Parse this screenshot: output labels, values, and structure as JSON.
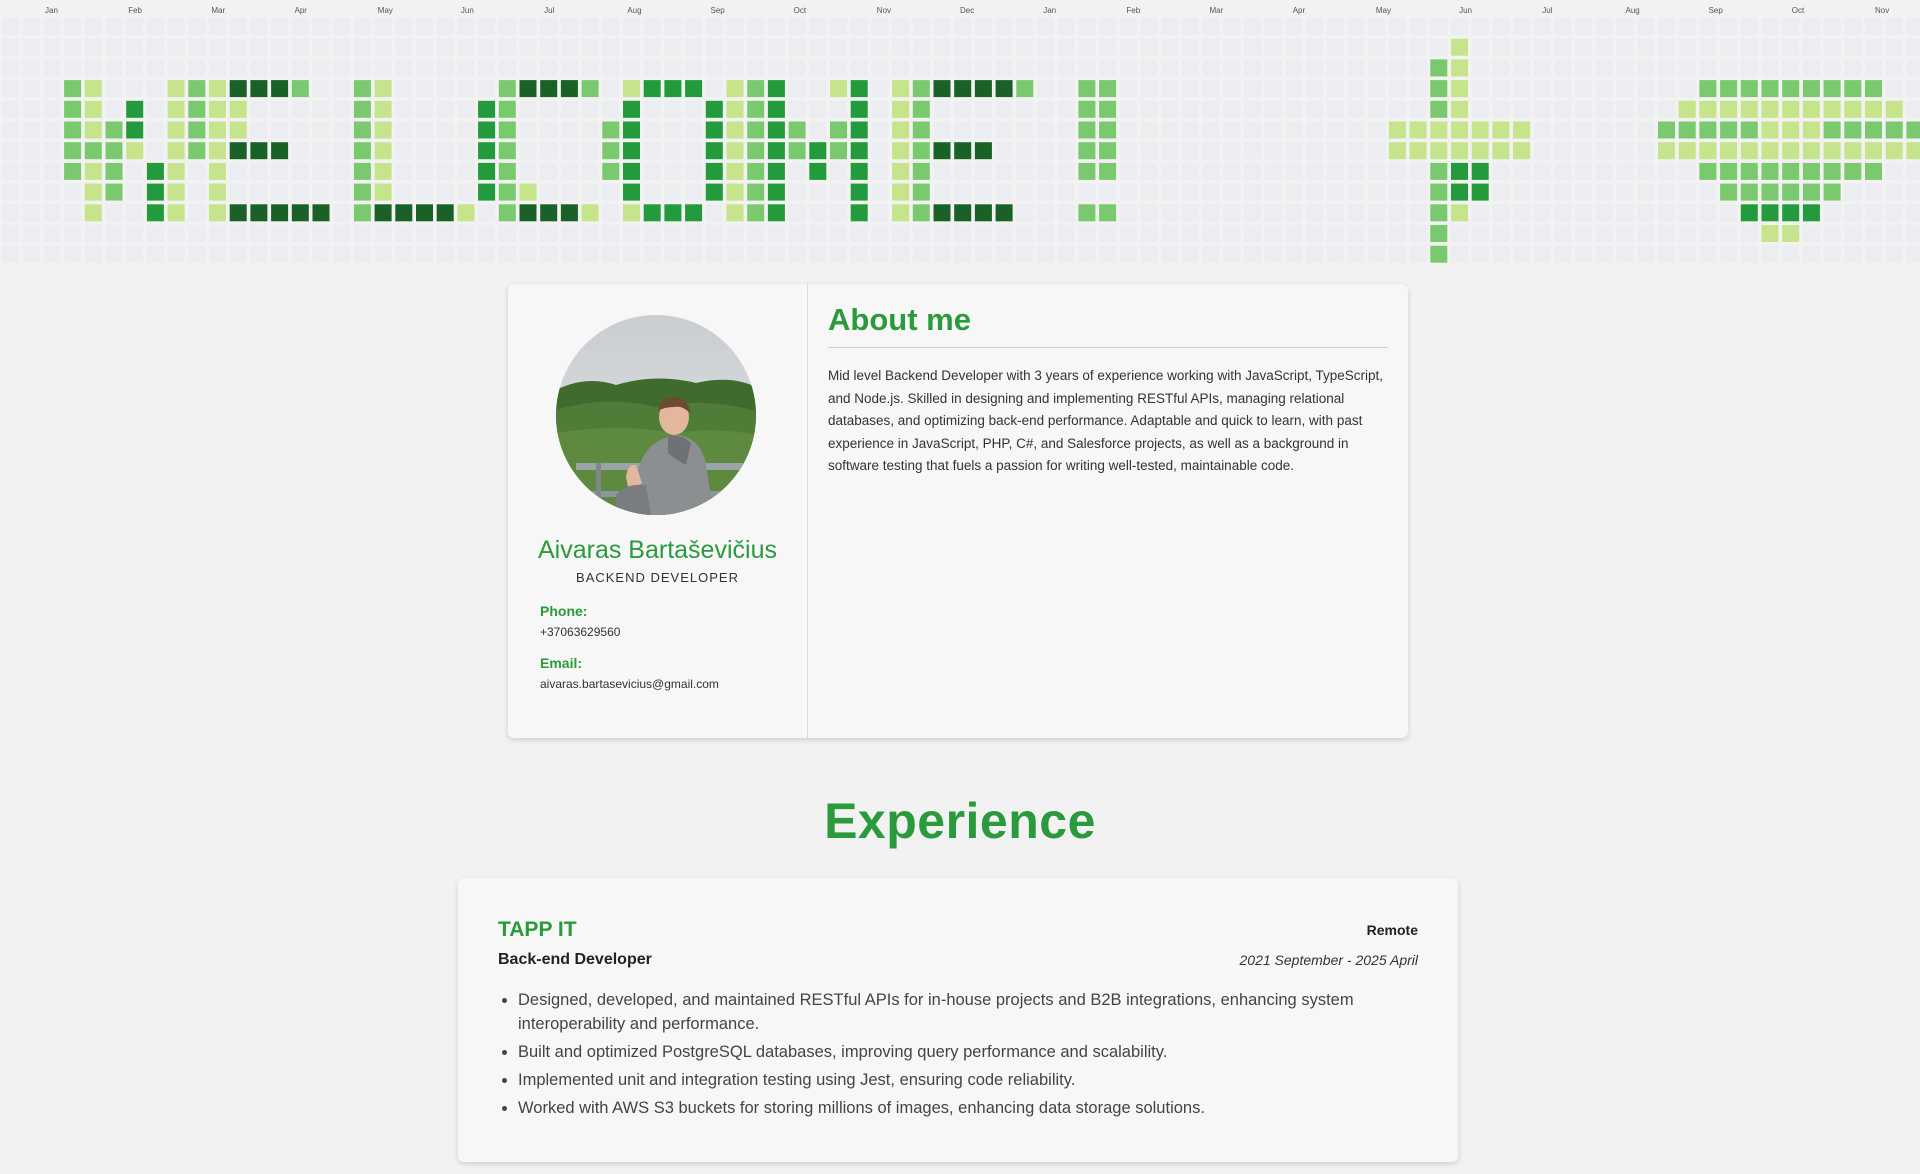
{
  "contributions": {
    "months": [
      "Jan",
      "Feb",
      "Mar",
      "Apr",
      "May",
      "Jun",
      "Jul",
      "Aug",
      "Sep",
      "Oct",
      "Nov",
      "Dec",
      "Jan",
      "Feb",
      "Mar",
      "Apr",
      "May",
      "Jun",
      "Jul",
      "Aug",
      "Sep",
      "Oct",
      "Nov"
    ],
    "colors": [
      "#ebedf0",
      "#c6e48b",
      "#7bc96f",
      "#239a3b",
      "#196127"
    ]
  },
  "profile": {
    "name": "Aivaras Bartaševičius",
    "role": "BACKEND DEVELOPER",
    "phone_label": "Phone:",
    "phone": "+37063629560",
    "email_label": "Email:",
    "email": "aivaras.bartasevicius@gmail.com"
  },
  "about": {
    "title": "About me",
    "text": "Mid level Backend Developer with 3 years of experience working with JavaScript, TypeScript, and Node.js. Skilled in designing and implementing RESTful APIs, managing relational databases, and optimizing back-end performance. Adaptable and quick to learn, with past experience in JavaScript, PHP, C#, and Salesforce projects, as well as a background in software testing that fuels a passion for writing well-tested, maintainable code."
  },
  "experience": {
    "heading": "Experience",
    "jobs": [
      {
        "company": "TAPP IT",
        "location": "Remote",
        "title": "Back-end Developer",
        "period": "2021 September - 2025 April",
        "bullets": [
          "Designed, developed, and maintained RESTful APIs for in-house projects and B2B integrations, enhancing system interoperability and performance.",
          "Built and optimized PostgreSQL databases, improving query performance and scalability.",
          "Implemented unit and integration testing using Jest, ensuring code reliability.",
          "Worked with AWS S3 buckets for storing millions of images, enhancing data storage solutions."
        ]
      }
    ]
  }
}
